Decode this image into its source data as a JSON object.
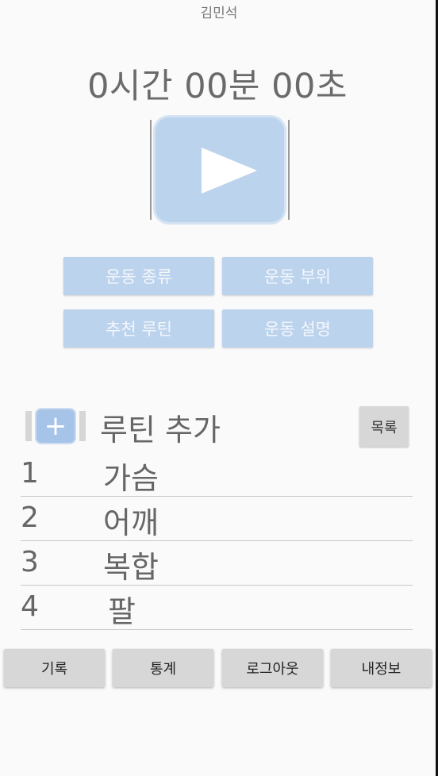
{
  "header": {
    "user_name": "김민석"
  },
  "timer": {
    "display": "0시간 00분 00초"
  },
  "play": {
    "icon": "play-icon"
  },
  "options": {
    "exercise_type": "운동 종류",
    "exercise_part": "운동 부위",
    "recommended_routine": "추천 루틴",
    "exercise_description": "운동 설명"
  },
  "routine": {
    "add_label": "루틴 추가",
    "add_icon": "plus-icon",
    "list_button": "목록",
    "items": [
      {
        "number": "1",
        "name": "가슴"
      },
      {
        "number": "2",
        "name": "어깨"
      },
      {
        "number": "3",
        "name": "복합"
      },
      {
        "number": "4",
        "name": "팔"
      }
    ]
  },
  "nav": {
    "records": "기록",
    "stats": "통계",
    "logout": "로그아웃",
    "my_info": "내정보"
  },
  "colors": {
    "accent": "#bcd3ed",
    "background": "#fafafa",
    "button_gray": "#d7d7d7"
  }
}
